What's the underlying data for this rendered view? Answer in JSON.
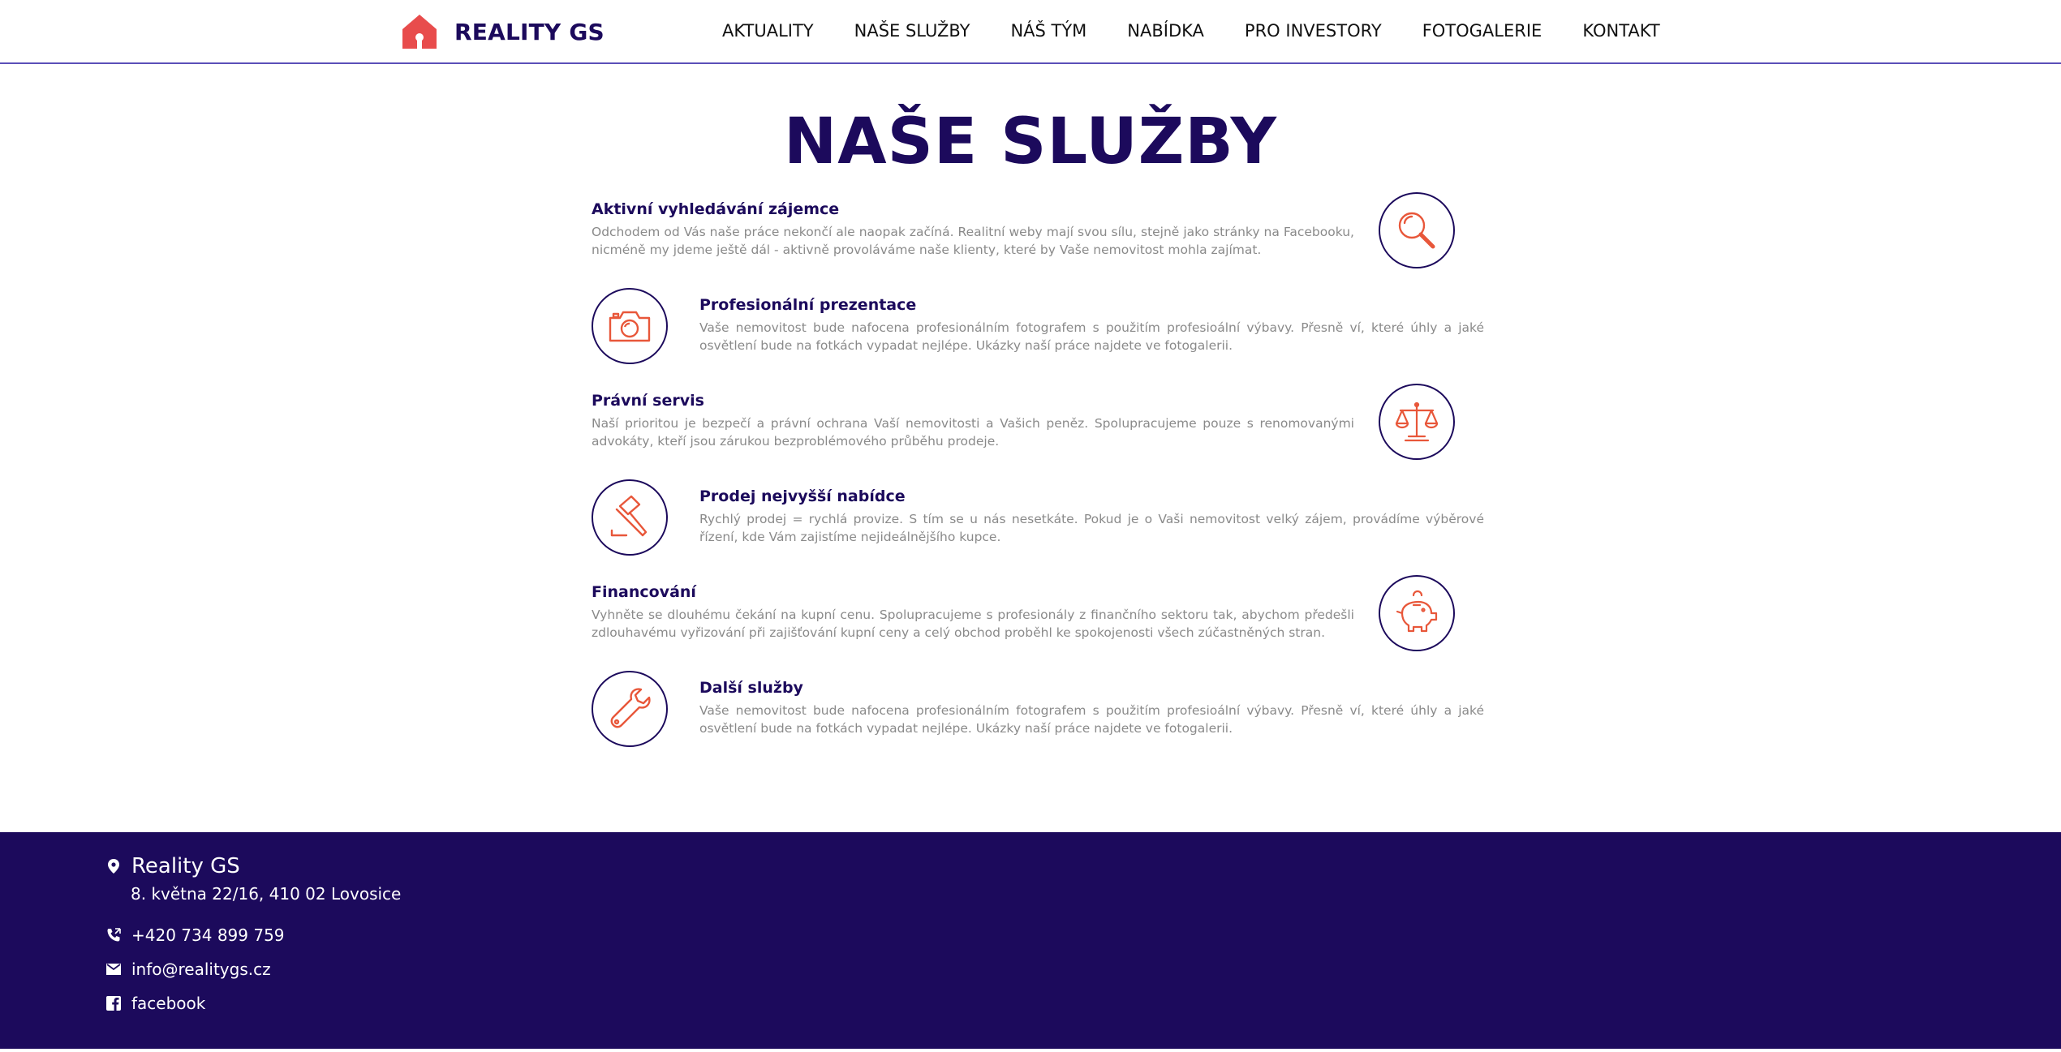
{
  "header": {
    "logo_text": "REALITY GS",
    "nav": [
      "AKTUALITY",
      "NAŠE SLUŽBY",
      "NÁŠ TÝM",
      "NABÍDKA",
      "PRO INVESTORY",
      "FOTOGALERIE",
      "KONTAKT"
    ]
  },
  "main": {
    "title": "NAŠE SLUŽBY",
    "services": [
      {
        "title": "Aktivní vyhledávání zájemce",
        "desc": "Odchodem od Vás naše práce nekončí ale naopak začíná. Realitní weby mají svou sílu, stejně jako stránky na Facebooku, nicméně my jdeme ještě dál - aktivně provoláváme naše klienty, které by Vaše nemovitost mohla zajímat.",
        "icon": "magnifier-icon"
      },
      {
        "title": "Profesionální prezentace",
        "desc": "Vaše nemovitost bude nafocena profesionálním fotografem s použitím profesioální výbavy. Přesně ví, které úhly a jaké osvětlení bude na fotkách vypadat nejlépe. Ukázky naší práce najdete ve fotogalerii.",
        "icon": "camera-icon"
      },
      {
        "title": "Právní servis",
        "desc": "Naší prioritou je bezpečí a právní ochrana Vaší nemovitosti a Vašich peněz. Spolupracujeme pouze s renomovanými advokáty, kteří jsou zárukou bezproblémového průběhu prodeje.",
        "icon": "scales-icon"
      },
      {
        "title": "Prodej nejvyšší nabídce",
        "desc": "Rychlý prodej = rychlá provize. S tím se u nás nesetkáte. Pokud je o Vaši nemovitost velký zájem, provádíme výběrové řízení, kde Vám zajistíme nejideálnějšího kupce.",
        "icon": "gavel-icon"
      },
      {
        "title": "Financování",
        "desc": "Vyhněte se dlouhému čekání na kupní cenu. Spolupracujeme s profesionály z finančního sektoru tak, abychom předešli zdlouhavému vyřizování při zajišťování kupní ceny a celý obchod proběhl ke spokojenosti všech zúčastněných stran.",
        "icon": "piggy-bank-icon"
      },
      {
        "title": "Další služby",
        "desc": "Vaše nemovitost bude nafocena profesionálním fotografem s použitím profesioální výbavy. Přesně ví, které úhly a jaké osvětlení bude na fotkách vypadat nejlépe. Ukázky naší práce najdete ve fotogalerii.",
        "icon": "wrench-icon"
      }
    ]
  },
  "footer": {
    "company": "Reality GS",
    "address": "8. května 22/16, 410 02 Lovosice",
    "phone": "+420 734 899 759",
    "email": "info@realitygs.cz",
    "facebook": "facebook"
  },
  "colors": {
    "primary": "#1c0a5c",
    "accent": "#e8573a",
    "logo": "#e84c4c",
    "text_muted": "#8a8a8a"
  }
}
